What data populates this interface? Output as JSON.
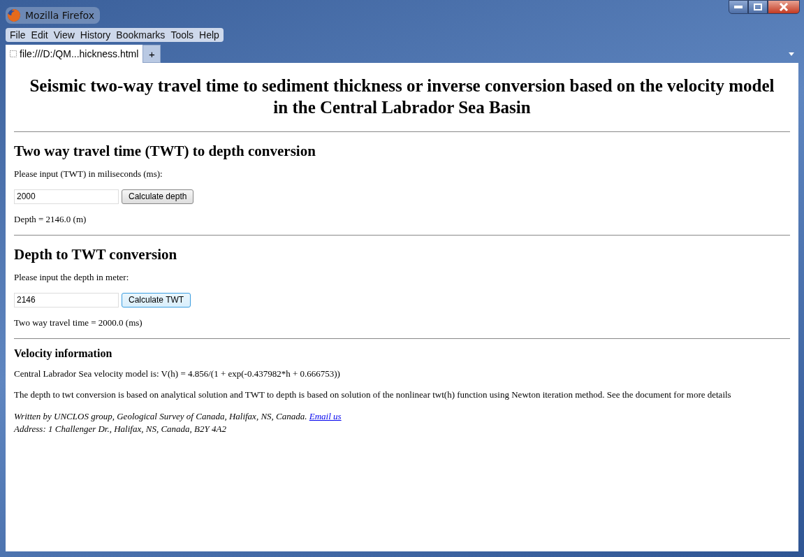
{
  "window": {
    "title": "Mozilla Firefox"
  },
  "menu": [
    "File",
    "Edit",
    "View",
    "History",
    "Bookmarks",
    "Tools",
    "Help"
  ],
  "tabs": [
    {
      "label": "file:///D:/QM...hickness.html",
      "selected": true
    }
  ],
  "new_tab": "+",
  "page": {
    "title": "Seismic two-way travel time to sediment thickness or inverse conversion based on the velocity model in the Central Labrador Sea Basin",
    "sections": [
      {
        "heading": "Two way travel time (TWT) to depth conversion",
        "prompt": "Please input (TWT) in miliseconds (ms):",
        "input": "2000",
        "button": "Calculate depth",
        "focused": false,
        "result": "Depth = 2146.0 (m)"
      },
      {
        "heading": "Depth to TWT conversion",
        "prompt": "Please input the depth in meter:",
        "input": "2146",
        "button": "Calculate TWT",
        "focused": true,
        "result": "Two way travel time = 2000.0 (ms)"
      }
    ],
    "info": {
      "heading": "Velocity information",
      "paragraphs": [
        "Central Labrador Sea velocity model is: V(h) = 4.856/(1 + exp(-0.437982*h + 0.666753))",
        "The depth to twt conversion is based on analytical solution and TWT to depth is based on solution of the nonlinear twt(h) function using Newton iteration method. See the document for more details"
      ]
    },
    "footer": {
      "credit": "Written by UNCLOS group, Geological Survey of Canada, Halifax, NS, Canada.",
      "link": "Email us",
      "address": "Address: 1 Challenger Dr., Halifax, NS, Canada, B2Y 4A2"
    }
  }
}
